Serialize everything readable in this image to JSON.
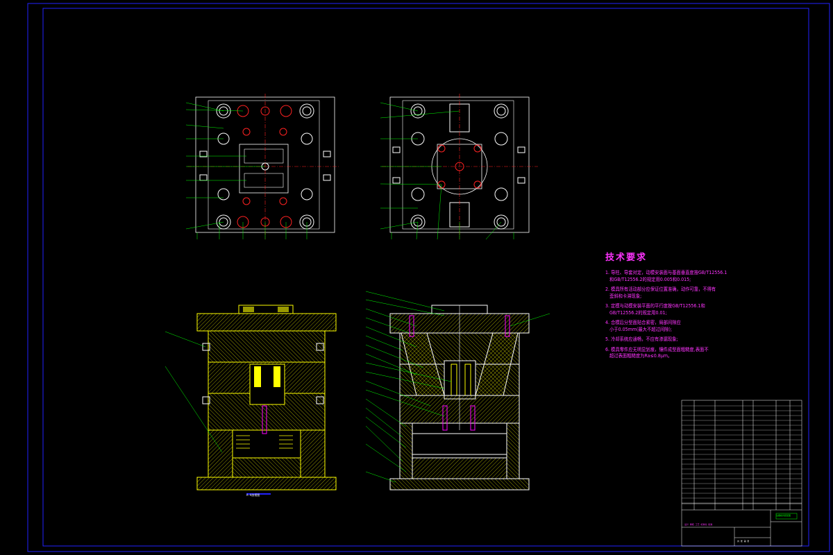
{
  "colors": {
    "background": "#000000",
    "border": "#2222ff",
    "outline": "#ffff00",
    "leader": "#00ff00",
    "centerline": "#ff2222",
    "text_magenta": "#ff33ff",
    "hatch": "#ffff00",
    "insert": "#ffff00",
    "pin": "#ff00ff"
  },
  "tech_requirements": {
    "title": "技术要求",
    "items": [
      "1. 导柱、导套对定，动模安装面与基面垂直度按GB/T12556.1\n   和GB/T12556.2的规定用0.005和0.015;",
      "2. 模具所有活动部分应保证位置准确，动作可靠，不得有\n   歪斜和卡滞现象;",
      "3. 定模与动模安装平面的平行度按GB/T12556.1和\n   GB/T12556.2的规定用0.01;",
      "4. 合模后分型面贴合紧密，局部间隙应\n   小于0.05mm(最大不超过间隙);",
      "5. 冷却系统应通畅，不应有渗漏现象;",
      "6. 模具零件应无明显划痕，镶件成型面粗糙度,表面不\n   超过表面粗糙度为Ra≤0.8μm。"
    ]
  },
  "view_captions": {
    "front_section_left": "A-A剖视图"
  },
  "title_block": {
    "drawing_name": "注塑模具装配图",
    "design_row": "设计  审核  工艺  标准化  批准",
    "footer_row": "共  张  第  张"
  }
}
